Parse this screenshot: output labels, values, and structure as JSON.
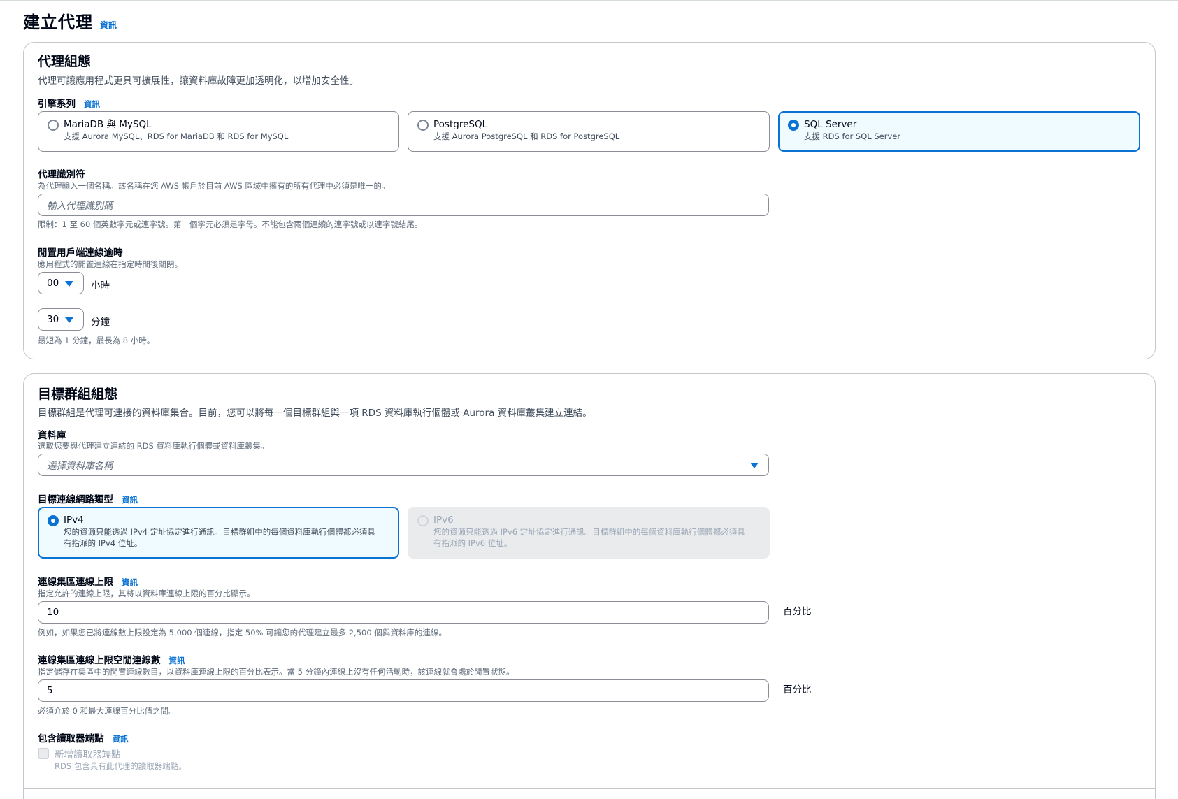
{
  "page": {
    "title": "建立代理",
    "info": "資訊"
  },
  "proxy_config": {
    "heading": "代理組態",
    "description": "代理可讓應用程式更具可擴展性，讓資料庫故障更加透明化，以增加安全性。",
    "engine": {
      "label": "引擎系列",
      "info": "資訊",
      "options": [
        {
          "title": "MariaDB 與 MySQL",
          "desc": "支援 Aurora MySQL、RDS for MariaDB 和 RDS for MySQL"
        },
        {
          "title": "PostgreSQL",
          "desc": "支援 Aurora PostgreSQL 和 RDS for PostgreSQL"
        },
        {
          "title": "SQL Server",
          "desc": "支援 RDS for SQL Server"
        }
      ],
      "selected": "SQL Server"
    },
    "identifier": {
      "label": "代理識別符",
      "description": "為代理輸入一個名稱。該名稱在您 AWS 帳戶於目前 AWS 區域中擁有的所有代理中必須是唯一的。",
      "placeholder": "輸入代理識別碼",
      "constraint": "限制：1 至 60 個英數字元或連字號。第一個字元必須是字母。不能包含兩個連續的連字號或以連字號結尾。"
    },
    "idle_timeout": {
      "label": "閒置用戶端連線逾時",
      "description": "應用程式的閒置連線在指定時間後關閉。",
      "hours_value": "00",
      "hours_unit": "小時",
      "minutes_value": "30",
      "minutes_unit": "分鐘",
      "constraint": "最短為 1 分鐘，最長為 8 小時。"
    }
  },
  "target_group": {
    "heading": "目標群組組態",
    "description": "目標群組是代理可連接的資料庫集合。目前，您可以將每一個目標群組與一項 RDS 資料庫執行個體或 Aurora 資料庫叢集建立連結。",
    "database": {
      "label": "資料庫",
      "description": "選取您要與代理建立連結的 RDS 資料庫執行個體或資料庫叢集。",
      "placeholder": "選擇資料庫名稱"
    },
    "network_type": {
      "label": "目標連線網路類型",
      "info": "資訊",
      "options": [
        {
          "title": "IPv4",
          "desc1": "您的資源只能透過 IPv4 定址協定進行通訊。目標群組中的每個資料庫執行個體都必須具",
          "desc2": "有指派的 IPv4 位址。"
        },
        {
          "title": "IPv6",
          "desc1": "您的資源只能透過 IPv6 定址協定進行通訊。目標群組中的每個資料庫執行個體都必須具",
          "desc2": "有指派的 IPv6 位址。"
        }
      ],
      "selected": "IPv4"
    },
    "max_connections": {
      "label": "連線集區連線上限",
      "info": "資訊",
      "description": "指定允許的連線上限，其將以資料庫連線上限的百分比顯示。",
      "value": "10",
      "unit": "百分比",
      "hint": "例如，如果您已將連線數上限設定為 5,000 個連線，指定 50% 可讓您的代理建立最多 2,500 個與資料庫的連線。"
    },
    "max_idle": {
      "label": "連線集區連線上限空閒連線數",
      "info": "資訊",
      "description": "指定儲存在集區中的閒置連線數目，以資料庫連線上限的百分比表示。當 5 分鐘內連線上沒有任何活動時，該連線就會處於閒置狀態。",
      "value": "5",
      "unit": "百分比",
      "hint": "必須介於 0 和最大連線百分比值之間。"
    },
    "reader_endpoint": {
      "label": "包含讀取器端點",
      "info": "資訊",
      "checkbox_label": "新增讀取器端點",
      "checkbox_desc": "RDS 包含具有此代理的讀取器端點。"
    }
  }
}
